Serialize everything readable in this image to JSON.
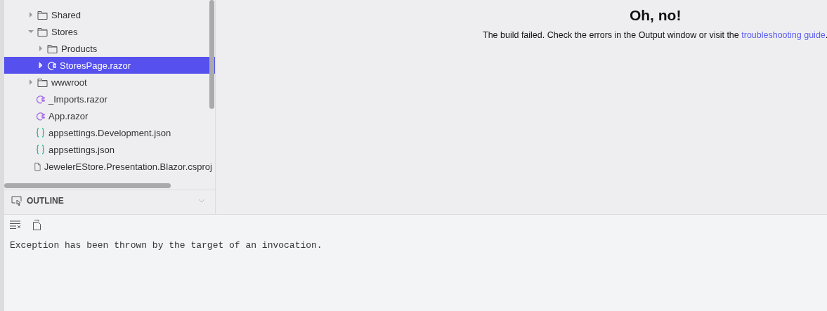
{
  "explorer": {
    "items": [
      {
        "label": "Shared",
        "kind": "folder",
        "expanded": false,
        "selected": false
      },
      {
        "label": "Stores",
        "kind": "folder",
        "expanded": true,
        "selected": false,
        "children": [
          {
            "label": "Products",
            "kind": "folder",
            "expanded": false,
            "selected": false
          },
          {
            "label": "StoresPage.razor",
            "kind": "razor",
            "expanded": false,
            "selected": true
          }
        ]
      },
      {
        "label": "wwwroot",
        "kind": "folder",
        "expanded": false,
        "selected": false
      },
      {
        "label": "_Imports.razor",
        "kind": "razor",
        "selected": false
      },
      {
        "label": "App.razor",
        "kind": "razor",
        "selected": false
      },
      {
        "label": "appsettings.Development.json",
        "kind": "json",
        "selected": false
      },
      {
        "label": "appsettings.json",
        "kind": "json",
        "selected": false
      },
      {
        "label": "JewelerEStore.Presentation.Blazor.csproj",
        "kind": "file",
        "selected": false
      }
    ]
  },
  "outline": {
    "title": "OUTLINE",
    "expanded": false
  },
  "preview": {
    "heading": "Oh, no!",
    "message": "The build failed. Check the errors in the Output window or visit the ",
    "link": "troubleshooting guide",
    "end": "."
  },
  "output": {
    "text": "Exception has been thrown by the target of an invocation."
  }
}
